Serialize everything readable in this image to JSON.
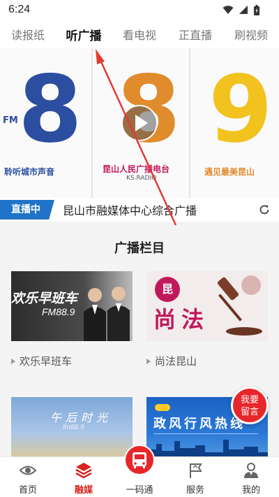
{
  "status_bar": {
    "time": "6:24"
  },
  "tabs": [
    {
      "label": "读报纸"
    },
    {
      "label": "听广播",
      "active": true
    },
    {
      "label": "看电视"
    },
    {
      "label": "正直播"
    },
    {
      "label": "刷视频"
    }
  ],
  "banner": {
    "panels": [
      {
        "number": "8",
        "fm": "FM",
        "caption": "聆听城市声音",
        "color": "#2c4ea0"
      },
      {
        "number": "8.",
        "caption": "昆山人民广播电台",
        "sub": "KS.RADIO",
        "color": "#e08b2c"
      },
      {
        "number": "9",
        "caption": "遇见最美昆山",
        "color": "#f2c21e"
      }
    ]
  },
  "live": {
    "tag": "直播中",
    "title": "昆山市融媒体中心综合广播"
  },
  "section": {
    "title": "广播栏目"
  },
  "programs": [
    {
      "label": "欢乐早班车",
      "thumb_title": "欢乐早班车",
      "thumb_sub": "FM88.9"
    },
    {
      "label": "尚法昆山",
      "thumb_title": "尚法"
    },
    {
      "label": "",
      "thumb_title": "午后时光",
      "thumb_sub": "fm88.9"
    },
    {
      "label": "",
      "thumb_title": "政风行风热线"
    }
  ],
  "float_button": {
    "line1": "我要",
    "line2": "留言"
  },
  "bottom_nav": [
    {
      "label": "首页",
      "icon": "eye-home-icon"
    },
    {
      "label": "融媒",
      "icon": "layers-icon",
      "active": true
    },
    {
      "label": "一码通",
      "icon": "bus-code-icon"
    },
    {
      "label": "服务",
      "icon": "flag-service-icon"
    },
    {
      "label": "我的",
      "icon": "person-icon"
    }
  ],
  "colors": {
    "accent": "#d8231f",
    "live_blue": "#1f73c8",
    "arrow": "#e53935"
  }
}
